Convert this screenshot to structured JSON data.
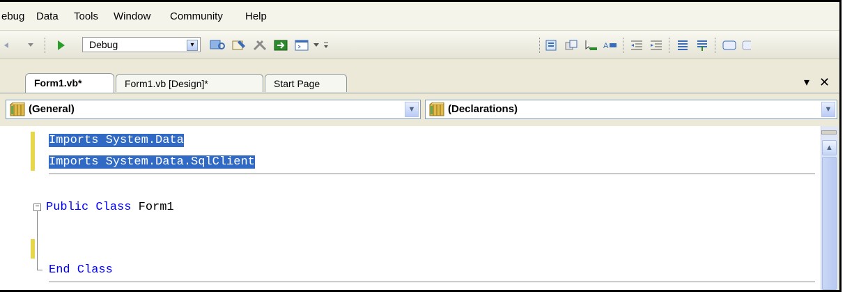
{
  "menu": {
    "items": [
      "ebug",
      "Data",
      "Tools",
      "Window",
      "Community",
      "Help"
    ]
  },
  "toolbar": {
    "configuration": "Debug",
    "left_icons": [
      "undo-icon",
      "dropdown-arrow-icon",
      "start-debugging-icon"
    ],
    "right_icons": [
      "find-icon",
      "properties-icon",
      "toolbox-icon",
      "object-browser-icon",
      "command-window-icon",
      "toolbar-options-icon"
    ],
    "format_icons": [
      "display-object-icon",
      "parameter-info-icon",
      "quick-info-icon",
      "complete-word-icon",
      "decrease-indent-icon",
      "increase-indent-icon",
      "comment-icon",
      "uncomment-icon",
      "bookmark-icon"
    ]
  },
  "tabs": [
    {
      "label": "Form1.vb*",
      "active": true
    },
    {
      "label": "Form1.vb [Design]*",
      "active": false
    },
    {
      "label": "Start Page",
      "active": false
    }
  ],
  "tab_controls": {
    "dropdown": "▾",
    "close": "✕"
  },
  "dropdowns": {
    "class_name": "(General)",
    "method_name": "(Declarations)"
  },
  "code": {
    "imports": [
      "Imports System.Data",
      "Imports System.Data.SqlClient"
    ],
    "class_open_keyword": "Public Class",
    "class_name": "Form1",
    "class_close": "End Class"
  },
  "colors": {
    "selection": "#316ac5",
    "keyword": "#0000ff",
    "change_margin": "#e6d74a"
  }
}
